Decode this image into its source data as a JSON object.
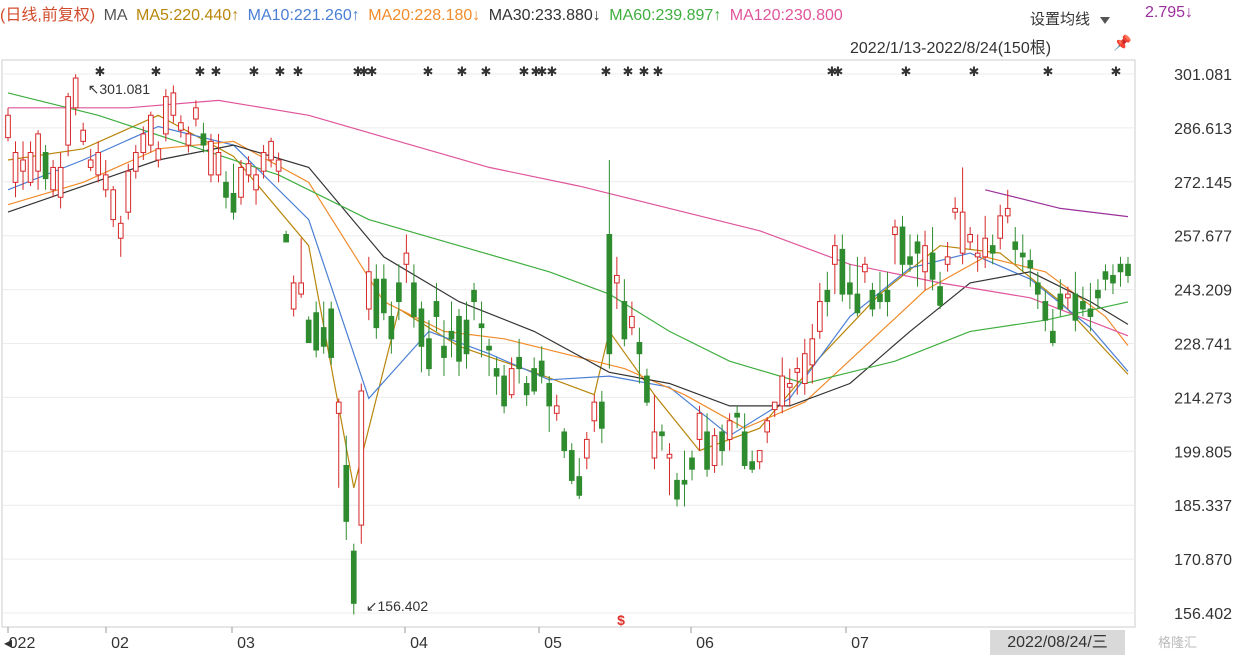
{
  "legend": {
    "prefix": "(日线,前复权)",
    "ma": "MA",
    "ma5": "MA5:220.440↑",
    "ma10": "MA10:221.260↑",
    "ma20": "MA20:228.180↓",
    "ma30": "MA30:233.880↓",
    "ma60": "MA60:239.897↑",
    "ma120": "MA120:230.800",
    "ma_tail": "2.795↓",
    "settings_label": "设置均线"
  },
  "range_label": "2022/1/13-2022/8/24(150根)",
  "cursor_date": "2022/08/24/三",
  "watermark": "格隆汇",
  "colors": {
    "up": "#d62728",
    "down": "#2e8b2e",
    "ma5": "#b8860b",
    "ma10": "#4a7fd4",
    "ma20": "#f08c2c",
    "ma30": "#333333",
    "ma60": "#3fae3f",
    "ma120": "#e0559b",
    "ma250": "#9b2f9b"
  },
  "chart_data": {
    "type": "candlestick",
    "title": "",
    "ylim": [
      156.402,
      301.081
    ],
    "y_ticks": [
      301.081,
      286.613,
      272.145,
      257.677,
      243.209,
      228.741,
      214.273,
      199.805,
      185.337,
      170.87,
      156.402
    ],
    "x_labels": [
      "022",
      "02",
      "03",
      "04",
      "05",
      "06",
      "07"
    ],
    "annotations": {
      "max": "301.081",
      "min": "156.402"
    },
    "grid": true,
    "candles": [
      [
        284,
        290,
        283,
        292
      ],
      [
        272,
        280,
        268,
        283
      ],
      [
        275,
        278,
        270,
        283
      ],
      [
        272,
        280,
        271,
        283
      ],
      [
        275,
        285,
        270,
        286
      ],
      [
        280,
        273,
        270,
        282
      ],
      [
        270,
        276,
        268,
        278
      ],
      [
        268,
        276,
        265,
        280
      ],
      [
        282,
        295,
        279,
        296
      ],
      [
        292,
        300,
        290,
        301
      ],
      [
        283,
        286,
        282,
        288
      ],
      [
        276,
        278,
        275,
        281
      ],
      [
        274,
        280,
        272,
        283
      ],
      [
        270,
        274,
        268,
        278
      ],
      [
        262,
        270,
        260,
        271
      ],
      [
        257,
        261,
        252,
        263
      ],
      [
        264,
        275,
        262,
        277
      ],
      [
        275,
        280,
        273,
        282
      ],
      [
        280,
        285,
        278,
        287
      ],
      [
        282,
        290,
        280,
        291
      ],
      [
        278,
        281,
        276,
        283
      ],
      [
        285,
        295,
        283,
        297
      ],
      [
        290,
        296,
        288,
        298
      ],
      [
        286,
        288,
        284,
        290
      ],
      [
        282,
        285,
        280,
        287
      ],
      [
        289,
        292,
        287,
        294
      ],
      [
        285,
        282,
        280,
        288
      ],
      [
        274,
        283,
        272,
        285
      ],
      [
        274,
        280,
        272,
        285
      ],
      [
        272,
        268,
        265,
        275
      ],
      [
        269,
        264,
        262,
        277
      ],
      [
        268,
        276,
        266,
        278
      ],
      [
        274,
        277,
        272,
        279
      ],
      [
        270,
        274,
        266,
        276
      ],
      [
        275,
        280,
        273,
        282
      ],
      [
        278,
        283,
        276,
        284
      ],
      [
        275,
        278,
        272,
        280
      ],
      [
        258,
        256,
        256,
        259
      ],
      [
        238,
        245,
        236,
        247
      ],
      [
        242,
        245,
        241,
        257
      ],
      [
        235,
        229,
        229,
        236
      ],
      [
        237,
        227,
        225,
        240
      ],
      [
        233,
        228,
        226,
        240
      ],
      [
        238,
        225,
        223,
        240
      ],
      [
        210,
        213,
        190,
        214
      ],
      [
        196,
        181,
        176,
        204
      ],
      [
        173,
        159,
        156,
        175
      ],
      [
        180,
        216,
        175,
        218
      ],
      [
        238,
        248,
        235,
        252
      ],
      [
        246,
        233,
        230,
        250
      ],
      [
        246,
        237,
        235,
        250
      ],
      [
        236,
        230,
        226,
        240
      ],
      [
        245,
        240,
        235,
        250
      ],
      [
        250,
        253,
        245,
        258
      ],
      [
        245,
        236,
        233,
        250
      ],
      [
        238,
        228,
        221,
        240
      ],
      [
        230,
        222,
        220,
        235
      ],
      [
        240,
        236,
        232,
        245
      ],
      [
        228,
        225,
        220,
        235
      ],
      [
        232,
        230,
        225,
        240
      ],
      [
        236,
        224,
        220,
        238
      ],
      [
        235,
        226,
        222,
        240
      ],
      [
        243,
        240,
        235,
        245
      ],
      [
        234,
        233,
        225,
        240
      ],
      [
        228,
        227,
        220,
        230
      ],
      [
        222,
        220,
        215,
        225
      ],
      [
        220,
        212,
        210,
        223
      ],
      [
        215,
        222,
        214,
        225
      ],
      [
        225,
        222,
        218,
        230
      ],
      [
        218,
        215,
        212,
        220
      ],
      [
        222,
        216,
        215,
        225
      ],
      [
        224,
        220,
        218,
        228
      ],
      [
        218,
        212,
        205,
        220
      ],
      [
        210,
        212,
        208,
        215
      ],
      [
        205,
        200,
        198,
        206
      ],
      [
        200,
        192,
        191,
        202
      ],
      [
        193,
        188,
        187,
        198
      ],
      [
        198,
        203,
        195,
        205
      ],
      [
        208,
        213,
        205,
        215
      ],
      [
        213,
        206,
        202,
        216
      ],
      [
        258,
        226,
        222,
        278
      ],
      [
        245,
        247,
        238,
        252
      ],
      [
        240,
        230,
        228,
        246
      ],
      [
        233,
        236,
        231,
        240
      ],
      [
        229,
        226,
        218,
        233
      ],
      [
        220,
        213,
        212,
        222
      ],
      [
        198,
        205,
        195,
        215
      ],
      [
        205,
        204,
        200,
        207
      ],
      [
        198,
        199,
        188,
        202
      ],
      [
        192,
        187,
        185,
        194
      ],
      [
        192,
        191,
        185,
        200
      ],
      [
        198,
        195,
        192,
        200
      ],
      [
        203,
        210,
        200,
        212
      ],
      [
        205,
        195,
        193,
        210
      ],
      [
        196,
        204,
        194,
        206
      ],
      [
        205,
        200,
        196,
        207
      ],
      [
        203,
        208,
        200,
        210
      ],
      [
        210,
        209,
        206,
        212
      ],
      [
        205,
        196,
        195,
        210
      ],
      [
        197,
        195,
        194,
        200
      ],
      [
        197,
        200,
        195,
        200
      ],
      [
        205,
        208,
        202,
        209
      ],
      [
        211,
        213,
        209,
        213
      ],
      [
        212,
        220,
        210,
        225
      ],
      [
        217,
        218,
        212,
        222
      ],
      [
        221,
        222,
        215,
        225
      ],
      [
        218,
        226,
        215,
        230
      ],
      [
        223,
        230,
        218,
        234
      ],
      [
        232,
        240,
        230,
        245
      ],
      [
        243,
        240,
        236,
        248
      ],
      [
        250,
        255,
        242,
        258
      ],
      [
        254,
        242,
        240,
        258
      ],
      [
        245,
        242,
        238,
        250
      ],
      [
        242,
        237,
        236,
        252
      ],
      [
        248,
        250,
        245,
        252
      ],
      [
        243,
        238,
        236,
        245
      ],
      [
        242,
        240,
        238,
        248
      ],
      [
        243,
        240,
        236,
        248
      ],
      [
        258,
        260,
        250,
        262
      ],
      [
        260,
        250,
        247,
        263
      ],
      [
        252,
        250,
        248,
        258
      ],
      [
        256,
        253,
        244,
        258
      ],
      [
        248,
        255,
        243,
        259
      ],
      [
        253,
        246,
        243,
        260
      ],
      [
        244,
        239,
        238,
        248
      ],
      [
        250,
        252,
        248,
        256
      ],
      [
        264,
        265,
        262,
        268
      ],
      [
        253,
        264,
        250,
        276
      ],
      [
        256,
        258,
        254,
        260
      ],
      [
        252,
        253,
        248,
        258
      ],
      [
        252,
        257,
        249,
        263
      ],
      [
        255,
        253,
        250,
        258
      ],
      [
        257,
        263,
        254,
        266
      ],
      [
        263,
        265,
        261,
        270
      ],
      [
        256,
        254,
        250,
        260
      ],
      [
        253,
        252,
        248,
        258
      ],
      [
        251,
        249,
        244,
        254
      ],
      [
        245,
        242,
        238,
        248
      ],
      [
        240,
        235,
        232,
        243
      ],
      [
        232,
        229,
        228,
        238
      ],
      [
        242,
        238,
        236,
        246
      ],
      [
        241,
        242,
        238,
        244
      ],
      [
        242,
        235,
        232,
        248
      ],
      [
        240,
        238,
        236,
        244
      ],
      [
        238,
        236,
        232,
        245
      ],
      [
        243,
        241,
        238,
        246
      ],
      [
        248,
        246,
        243,
        250
      ],
      [
        247,
        245,
        242,
        250
      ],
      [
        250,
        248,
        244,
        252
      ],
      [
        250,
        247,
        245,
        252
      ]
    ],
    "ma_lines": {
      "MA5": [
        [
          0,
          278
        ],
        [
          10,
          281
        ],
        [
          20,
          290
        ],
        [
          30,
          279
        ],
        [
          40,
          255
        ],
        [
          46,
          190
        ],
        [
          52,
          238
        ],
        [
          60,
          228
        ],
        [
          70,
          221
        ],
        [
          78,
          215
        ],
        [
          80,
          232
        ],
        [
          86,
          215
        ],
        [
          92,
          200
        ],
        [
          100,
          206
        ],
        [
          108,
          225
        ],
        [
          116,
          242
        ],
        [
          124,
          255
        ],
        [
          132,
          253
        ],
        [
          140,
          240
        ],
        [
          149,
          220.44
        ]
      ],
      "MA10": [
        [
          0,
          270
        ],
        [
          10,
          278
        ],
        [
          20,
          287
        ],
        [
          30,
          282
        ],
        [
          40,
          262
        ],
        [
          48,
          214
        ],
        [
          56,
          232
        ],
        [
          64,
          226
        ],
        [
          72,
          219
        ],
        [
          80,
          220
        ],
        [
          88,
          217
        ],
        [
          96,
          204
        ],
        [
          104,
          214
        ],
        [
          112,
          236
        ],
        [
          120,
          249
        ],
        [
          128,
          253
        ],
        [
          136,
          246
        ],
        [
          144,
          233
        ],
        [
          149,
          221.26
        ]
      ],
      "MA20": [
        [
          0,
          266
        ],
        [
          10,
          272
        ],
        [
          20,
          281
        ],
        [
          30,
          283
        ],
        [
          40,
          272
        ],
        [
          50,
          240
        ],
        [
          58,
          232
        ],
        [
          66,
          230
        ],
        [
          74,
          226
        ],
        [
          82,
          222
        ],
        [
          90,
          215
        ],
        [
          98,
          206
        ],
        [
          106,
          213
        ],
        [
          114,
          228
        ],
        [
          122,
          243
        ],
        [
          130,
          252
        ],
        [
          138,
          248
        ],
        [
          146,
          236
        ],
        [
          149,
          228.18
        ]
      ],
      "MA30": [
        [
          0,
          264
        ],
        [
          10,
          271
        ],
        [
          20,
          278
        ],
        [
          30,
          282
        ],
        [
          40,
          276
        ],
        [
          50,
          252
        ],
        [
          60,
          240
        ],
        [
          70,
          232
        ],
        [
          80,
          221
        ],
        [
          88,
          218
        ],
        [
          96,
          212
        ],
        [
          104,
          212
        ],
        [
          112,
          218
        ],
        [
          120,
          232
        ],
        [
          128,
          245
        ],
        [
          136,
          248
        ],
        [
          144,
          240
        ],
        [
          149,
          233.88
        ]
      ],
      "MA60": [
        [
          0,
          296
        ],
        [
          12,
          290
        ],
        [
          24,
          282
        ],
        [
          36,
          274
        ],
        [
          48,
          262
        ],
        [
          60,
          255
        ],
        [
          72,
          248
        ],
        [
          80,
          242
        ],
        [
          88,
          232
        ],
        [
          96,
          224
        ],
        [
          106,
          218
        ],
        [
          118,
          224
        ],
        [
          128,
          232
        ],
        [
          138,
          235
        ],
        [
          149,
          239.897
        ]
      ],
      "MA120": [
        [
          0,
          292
        ],
        [
          16,
          292
        ],
        [
          28,
          294
        ],
        [
          40,
          290
        ],
        [
          52,
          283
        ],
        [
          64,
          276
        ],
        [
          76,
          271
        ],
        [
          88,
          265
        ],
        [
          100,
          259
        ],
        [
          112,
          250
        ],
        [
          124,
          245
        ],
        [
          136,
          241
        ],
        [
          149,
          230.8
        ]
      ],
      "MA250": [
        [
          130,
          270
        ],
        [
          140,
          265
        ],
        [
          149,
          262.795
        ]
      ]
    }
  }
}
